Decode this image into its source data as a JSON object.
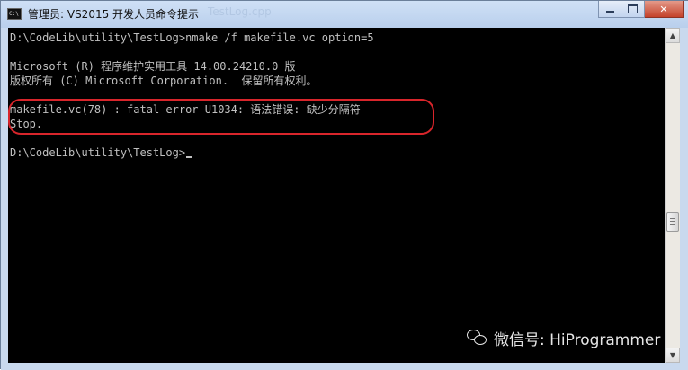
{
  "window": {
    "title": "管理员: VS2015 开发人员命令提示",
    "title_icon_label": "C:\\",
    "background_hint_text": "TestLog.cpp",
    "controls": {
      "minimize": "minimize",
      "maximize": "maximize",
      "close": "✕"
    }
  },
  "console": {
    "lines": [
      "D:\\CodeLib\\utility\\TestLog>nmake /f makefile.vc option=5",
      "",
      "Microsoft (R) 程序维护实用工具 14.00.24210.0 版",
      "版权所有 (C) Microsoft Corporation.  保留所有权利。",
      "",
      "makefile.vc(78) : fatal error U1034: 语法错误: 缺少分隔符",
      "Stop.",
      "",
      "D:\\CodeLib\\utility\\TestLog>"
    ]
  },
  "watermark": {
    "text": "微信号: HiProgrammer"
  },
  "scrollbar": {
    "up_arrow": "▲",
    "down_arrow": "▼"
  },
  "colors": {
    "console_bg": "#000000",
    "console_text": "#c0c0c0",
    "highlight_border": "#d8252b",
    "title_bar": "#c9d9ee",
    "close_button": "#c4422b"
  },
  "icons": [
    "console-app-icon",
    "minimize-icon",
    "maximize-icon",
    "close-icon",
    "wechat-icon",
    "scroll-up-icon",
    "scroll-down-icon"
  ]
}
